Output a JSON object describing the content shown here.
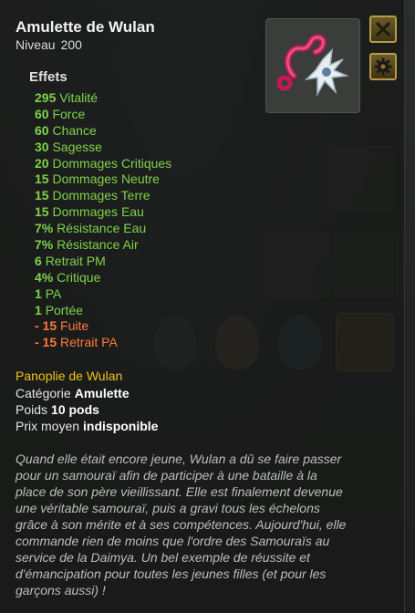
{
  "item": {
    "name": "Amulette de Wulan",
    "level_label": "Niveau",
    "level_value": "200"
  },
  "effects_title": "Effets",
  "effects": [
    {
      "value": "295",
      "label": "Vitalité",
      "kind": "positive"
    },
    {
      "value": "60",
      "label": "Force",
      "kind": "positive"
    },
    {
      "value": "60",
      "label": "Chance",
      "kind": "positive"
    },
    {
      "value": "30",
      "label": "Sagesse",
      "kind": "positive"
    },
    {
      "value": "20",
      "label": "Dommages Critiques",
      "kind": "positive"
    },
    {
      "value": "15",
      "label": "Dommages Neutre",
      "kind": "positive"
    },
    {
      "value": "15",
      "label": "Dommages Terre",
      "kind": "positive"
    },
    {
      "value": "15",
      "label": "Dommages Eau",
      "kind": "positive"
    },
    {
      "value": "7%",
      "label": "Résistance Eau",
      "kind": "positive"
    },
    {
      "value": "7%",
      "label": "Résistance Air",
      "kind": "positive"
    },
    {
      "value": "6",
      "label": "Retrait PM",
      "kind": "positive"
    },
    {
      "value": "4%",
      "label": "Critique",
      "kind": "positive"
    },
    {
      "value": "1",
      "label": "PA",
      "kind": "positive"
    },
    {
      "value": "1",
      "label": "Portée",
      "kind": "positive"
    },
    {
      "value": "- 15",
      "label": "Fuite",
      "kind": "negative"
    },
    {
      "value": "- 15",
      "label": "Retrait PA",
      "kind": "negative"
    }
  ],
  "set_name": "Panoplie de Wulan",
  "info": {
    "category_label": "Catégorie",
    "category_value": "Amulette",
    "weight_label": "Poids",
    "weight_value": "10 pods",
    "price_label": "Prix moyen",
    "price_value": "indisponible"
  },
  "description": "Quand elle était encore jeune, Wulan a dû se faire passer pour un samouraï afin de participer à une bataille à la place de son père vieillissant. Elle est finalement devenue une véritable samouraï, puis a gravi tous les échelons grâce à son mérite et à ses compétences. Aujourd'hui, elle commande rien de moins que l'ordre des Samouraïs au service de la Daimya. Un bel exemple de réussite et d'émancipation pour toutes les jeunes filles (et pour les garçons aussi) !",
  "icons": {
    "close": "close-icon",
    "settings": "gear-icon",
    "item": "amulet-icon"
  },
  "colors": {
    "positive": "#7ed34a",
    "negative": "#ff7a3c",
    "set": "#f0c419",
    "button_border": "#b89b45"
  }
}
